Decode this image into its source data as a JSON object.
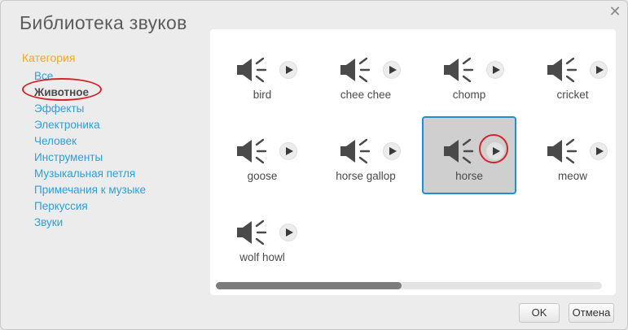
{
  "dialog": {
    "title": "Библиотека звуков",
    "close_icon": "close-icon"
  },
  "sidebar": {
    "category_title": "Категория",
    "items": [
      {
        "label": "Все",
        "selected": false
      },
      {
        "label": "Животное",
        "selected": true
      },
      {
        "label": "Эффекты",
        "selected": false
      },
      {
        "label": "Электроника",
        "selected": false
      },
      {
        "label": "Человек",
        "selected": false
      },
      {
        "label": "Инструменты",
        "selected": false
      },
      {
        "label": "Музыкальная петля",
        "selected": false
      },
      {
        "label": "Примечания к музыке",
        "selected": false
      },
      {
        "label": "Перкуссия",
        "selected": false
      },
      {
        "label": "Звуки",
        "selected": false
      }
    ]
  },
  "sounds": [
    {
      "name": "bird",
      "selected": false
    },
    {
      "name": "chee chee",
      "selected": false
    },
    {
      "name": "chomp",
      "selected": false
    },
    {
      "name": "cricket",
      "selected": false
    },
    {
      "name": "goose",
      "selected": false
    },
    {
      "name": "horse gallop",
      "selected": false
    },
    {
      "name": "horse",
      "selected": true
    },
    {
      "name": "meow",
      "selected": false
    },
    {
      "name": "wolf howl",
      "selected": false
    }
  ],
  "icons": {
    "speaker": "speaker-icon",
    "play": "play-icon"
  },
  "scrollbar": {
    "position_fraction": 0.0,
    "visible_fraction": 0.48
  },
  "buttons": {
    "ok": "OK",
    "cancel": "Отмена"
  },
  "colors": {
    "category_title": "#f5a623",
    "category_link": "#2aa0d8",
    "selection_border": "#1f8fd3",
    "highlight_circle": "#d4232a"
  }
}
